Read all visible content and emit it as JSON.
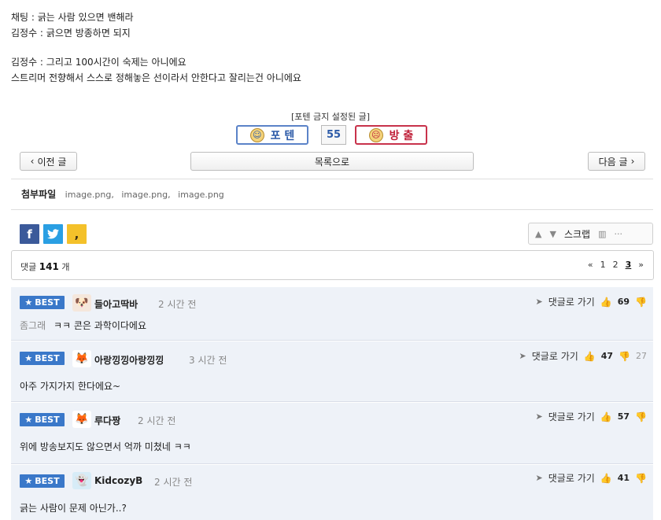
{
  "post": {
    "lines": [
      "채팅 : 긁는 사람 있으면 밴해라",
      "김정수 : 긁으면 방종하면 되지",
      "김정수 : 그리고 100시간이 숙제는 아니에요",
      "스트리머 전향해서 스스로 정해놓은 선이라서 안한다고 잘리는건 아니에요"
    ]
  },
  "vote": {
    "caption": "[포텐 금지 설정된 글]",
    "up_label": "포 텐",
    "count": "55",
    "down_label": "방 출"
  },
  "nav": {
    "prev": "이전 글",
    "list": "목록으로",
    "next": "다음 글"
  },
  "attachments": {
    "label": "첨부파일",
    "files": [
      "image.png,",
      "image.png,",
      "image.png"
    ]
  },
  "tools": {
    "scrap": "스크랩"
  },
  "comments_header": {
    "prefix": "댓글",
    "count": "141",
    "suffix": "개",
    "pages": [
      "«",
      "1",
      "2",
      "3",
      "»"
    ],
    "current_page": "3"
  },
  "comments": [
    {
      "badge": "BEST",
      "nick": "들아고딱바",
      "time": "2 시간 전",
      "reply_label": "댓글로 가기",
      "likes": "69",
      "dislikes": "",
      "quote": "좀그래",
      "text": "ㅋㅋ 콘은 과학이다에요",
      "avatar_icon": "dog-face-icon"
    },
    {
      "badge": "BEST",
      "nick": "아랑낑낑아랑낑낑",
      "time": "3 시간 전",
      "reply_label": "댓글로 가기",
      "likes": "47",
      "dislikes": "27",
      "quote": "",
      "text": "아주 가지가지 한다에요~",
      "avatar_icon": "fox-face-icon"
    },
    {
      "badge": "BEST",
      "nick": "루다짱",
      "time": "2 시간 전",
      "reply_label": "댓글로 가기",
      "likes": "57",
      "dislikes": "",
      "quote": "",
      "text": "위에 방송보지도 않으면서 억까 미쳤네 ㅋㅋ",
      "avatar_icon": "fox-face-icon"
    },
    {
      "badge": "BEST",
      "nick": "KidcozyB",
      "time": "2 시간 전",
      "reply_label": "댓글로 가기",
      "likes": "41",
      "dislikes": "",
      "quote": "",
      "text": "긁는 사람이 문제 아닌가..?",
      "avatar_icon": "blue-creature-icon"
    }
  ]
}
